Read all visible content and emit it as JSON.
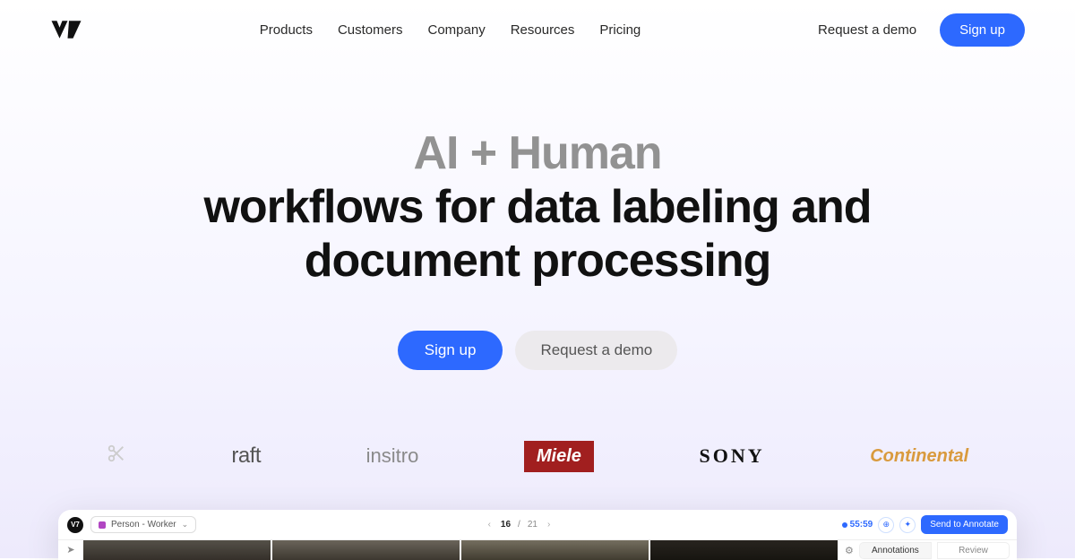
{
  "nav": {
    "items": [
      "Products",
      "Customers",
      "Company",
      "Resources",
      "Pricing"
    ],
    "demo": "Request a demo",
    "signup": "Sign up"
  },
  "hero": {
    "title_grey": "AI + Human",
    "title_black_1": "workflows for data labeling and",
    "title_black_2": "document processing",
    "cta_primary": "Sign up",
    "cta_secondary": "Request a demo"
  },
  "clients": {
    "raft": "raft",
    "insitro": "insitro",
    "miele": "Miele",
    "sony": "SONY",
    "continental": "Continental"
  },
  "app": {
    "brand": "V7",
    "tag": "Person - Worker",
    "page_current": "16",
    "page_sep": "/",
    "page_total": "21",
    "timer": "55:59",
    "send": "Send to Annotate",
    "tab_annotations": "Annotations",
    "tab_review": "Review"
  }
}
